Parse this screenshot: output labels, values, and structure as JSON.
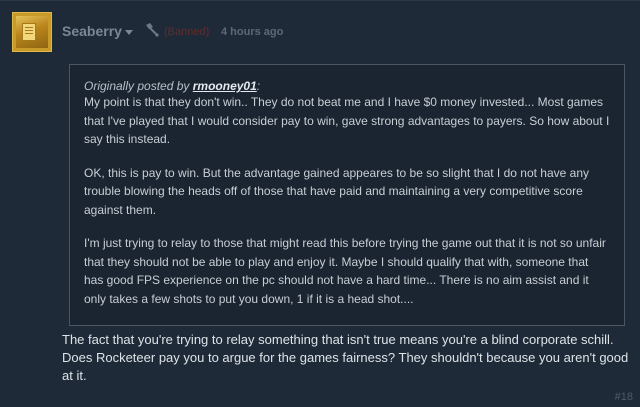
{
  "post": {
    "author": "Seaberry",
    "status": "(Banned)",
    "time": "4 hours ago",
    "icons": {
      "caret": "chevron-down-icon",
      "flag": "flag-icon",
      "avatar": "avatar-image"
    },
    "quote": {
      "prefix": "Originally posted by ",
      "author": "rmooney01",
      "suffix": ":",
      "paragraphs": [
        "My point is that they don't win.. They do not beat me and I have $0 money invested... Most games that I've played that I would consider pay to win, gave strong advantages to payers. So how about I say this instead.",
        "OK, this is pay to win. But the advantage gained appeares to be so slight that I do not have any trouble blowing the heads off of those that have paid and maintaining a very competitive score against them.",
        "I'm just trying to relay to those that might read this before trying the game out that it is not so unfair that they should not be able to play and enjoy it. Maybe I should qualify that with, someone that has good FPS experience on the pc should not have a hard time... There is no aim assist and it only takes a few shots to put you down, 1 if it is a head shot...."
      ]
    },
    "reply": "The fact that you're trying to relay something that isn't true means you're a blind corporate schill. Does Rocketeer pay you to argue for the games fairness? They shouldn't because you aren't good at it.",
    "number": "#18"
  },
  "colors": {
    "background": "#1e2a37",
    "author": "#7b8794",
    "banned": "#5c2f2f",
    "text": "#dde3e8"
  }
}
